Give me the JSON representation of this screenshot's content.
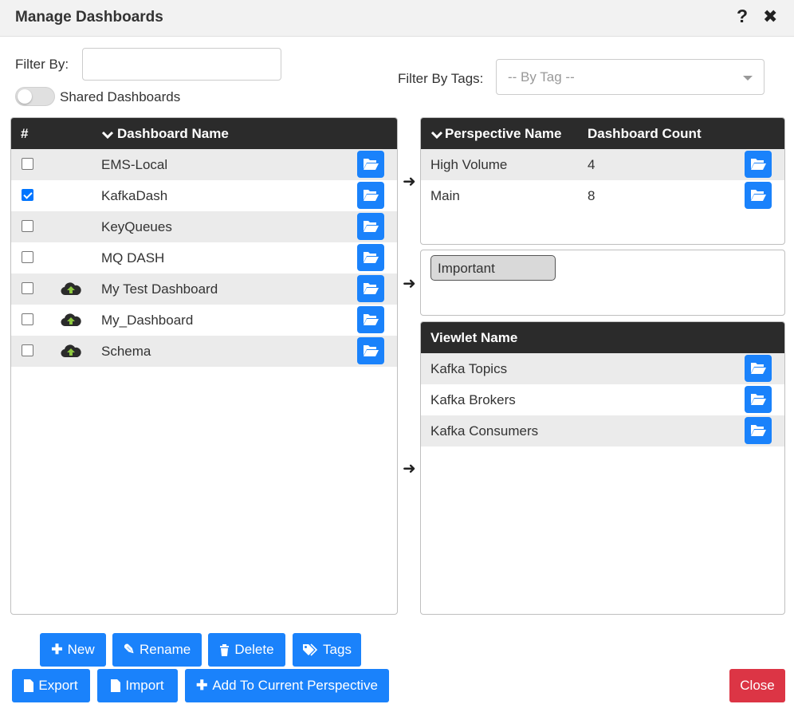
{
  "dialog": {
    "title": "Manage Dashboards",
    "help": "?",
    "close": "✖"
  },
  "filters": {
    "filter_by_label": "Filter By:",
    "filter_value": "",
    "shared_label": "Shared Dashboards",
    "shared_on": false,
    "tags_label": "Filter By Tags:",
    "tags_placeholder": "-- By Tag --"
  },
  "dashboards": {
    "headers": {
      "num": "#",
      "name": "Dashboard Name"
    },
    "rows": [
      {
        "name": "EMS-Local",
        "checked": false,
        "cloud": false
      },
      {
        "name": "KafkaDash",
        "checked": true,
        "cloud": false
      },
      {
        "name": "KeyQueues",
        "checked": false,
        "cloud": false
      },
      {
        "name": "MQ DASH",
        "checked": false,
        "cloud": false
      },
      {
        "name": "My Test Dashboard",
        "checked": false,
        "cloud": true
      },
      {
        "name": "My_Dashboard",
        "checked": false,
        "cloud": true
      },
      {
        "name": "Schema",
        "checked": false,
        "cloud": true
      }
    ]
  },
  "perspectives": {
    "headers": {
      "name": "Perspective Name",
      "count": "Dashboard Count"
    },
    "rows": [
      {
        "name": "High Volume",
        "count": "4"
      },
      {
        "name": "Main",
        "count": "8"
      }
    ]
  },
  "tags": {
    "items": [
      "Important"
    ]
  },
  "viewlets": {
    "header": "Viewlet Name",
    "rows": [
      "Kafka Topics",
      "Kafka Brokers",
      "Kafka Consumers"
    ]
  },
  "buttons": {
    "new": "New",
    "rename": "Rename",
    "delete": "Delete",
    "tags": "Tags",
    "export": "Export",
    "import": "Import",
    "add_to_perspective": "Add To Current Perspective",
    "close": "Close"
  },
  "colors": {
    "primary": "#1a82fb",
    "danger": "#dc3545",
    "header": "#2b2b2b",
    "cloud_arrow": "#8cc63f"
  }
}
